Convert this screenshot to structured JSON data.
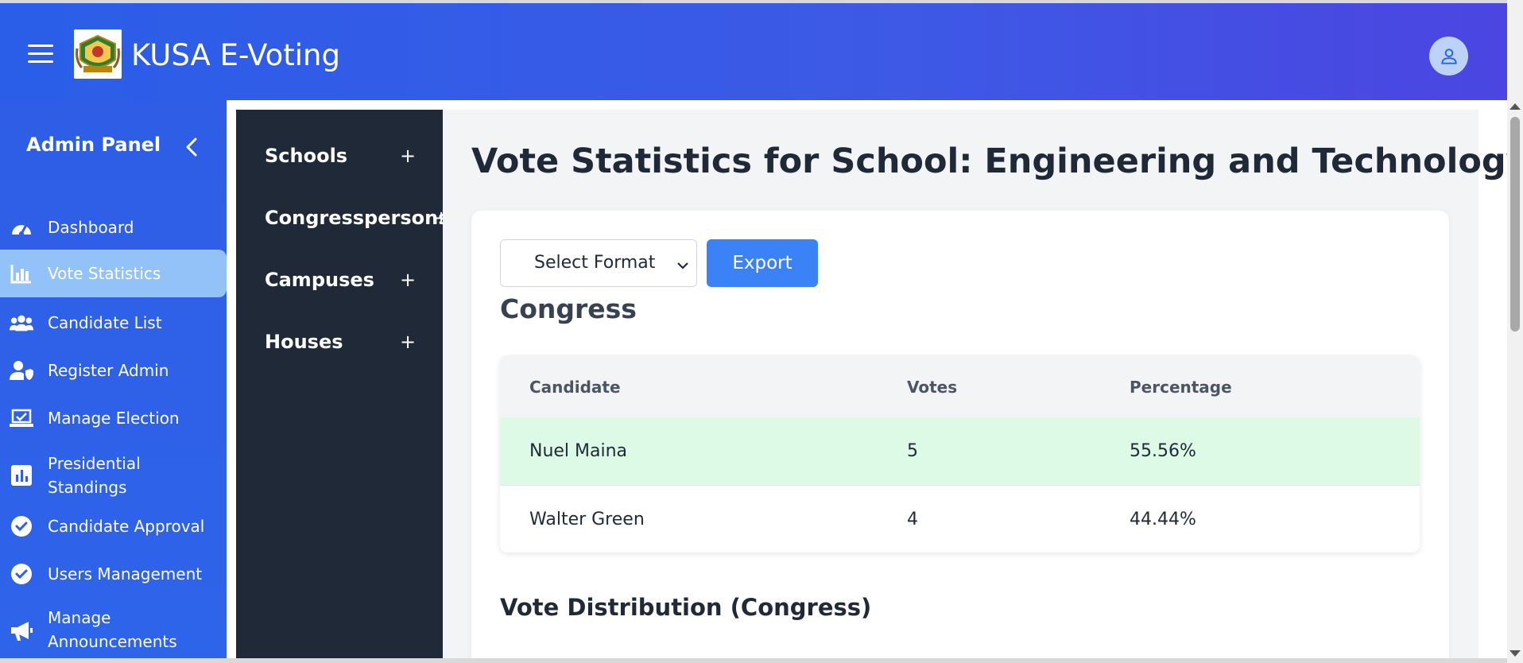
{
  "header": {
    "app_title": "KUSA E-Voting",
    "accent_color": "#2a5ee8"
  },
  "sidebar": {
    "title": "Admin Panel",
    "items": [
      {
        "label": "Dashboard",
        "icon": "gauge-icon"
      },
      {
        "label": "Vote Statistics",
        "icon": "bar-chart-icon",
        "active": true
      },
      {
        "label": "Candidate List",
        "icon": "users-icon"
      },
      {
        "label": "Register Admin",
        "icon": "user-shield-icon"
      },
      {
        "label": "Manage Election",
        "icon": "laptop-check-icon"
      },
      {
        "label": "Presidential Standings",
        "label_line1": "Presidential",
        "label_line2": "Standings",
        "icon": "chart-square-icon"
      },
      {
        "label": "Candidate Approval",
        "icon": "check-circle-icon"
      },
      {
        "label": "Users Management",
        "icon": "check-circle-icon"
      },
      {
        "label": "Manage Announcements",
        "label_line1": "Manage",
        "label_line2": "Announcements",
        "icon": "megaphone-icon"
      }
    ]
  },
  "submenu": {
    "items": [
      {
        "label": "Schools",
        "expand": "+"
      },
      {
        "label": "Congresspersons",
        "expand": "+"
      },
      {
        "label": "Campuses",
        "expand": "+"
      },
      {
        "label": "Houses",
        "expand": "+"
      }
    ]
  },
  "main": {
    "page_title": "Vote Statistics for School: Engineering and Technology",
    "select_format": {
      "selected": "Select Format"
    },
    "export_label": "Export",
    "section_heading": "Congress",
    "table": {
      "columns": [
        "Candidate",
        "Votes",
        "Percentage"
      ],
      "rows": [
        {
          "candidate": "Nuel Maina",
          "votes": "5",
          "percentage": "55.56%"
        },
        {
          "candidate": "Walter Green",
          "votes": "4",
          "percentage": "44.44%"
        }
      ]
    },
    "distribution_heading": "Vote Distribution (Congress)"
  },
  "colors": {
    "sidebar_bg": "#2f5de6",
    "active_item_bg": "#93c2f8",
    "submenu_bg": "#1f2937",
    "export_button": "#3b82f6",
    "winner_row": "#dcfae6"
  }
}
